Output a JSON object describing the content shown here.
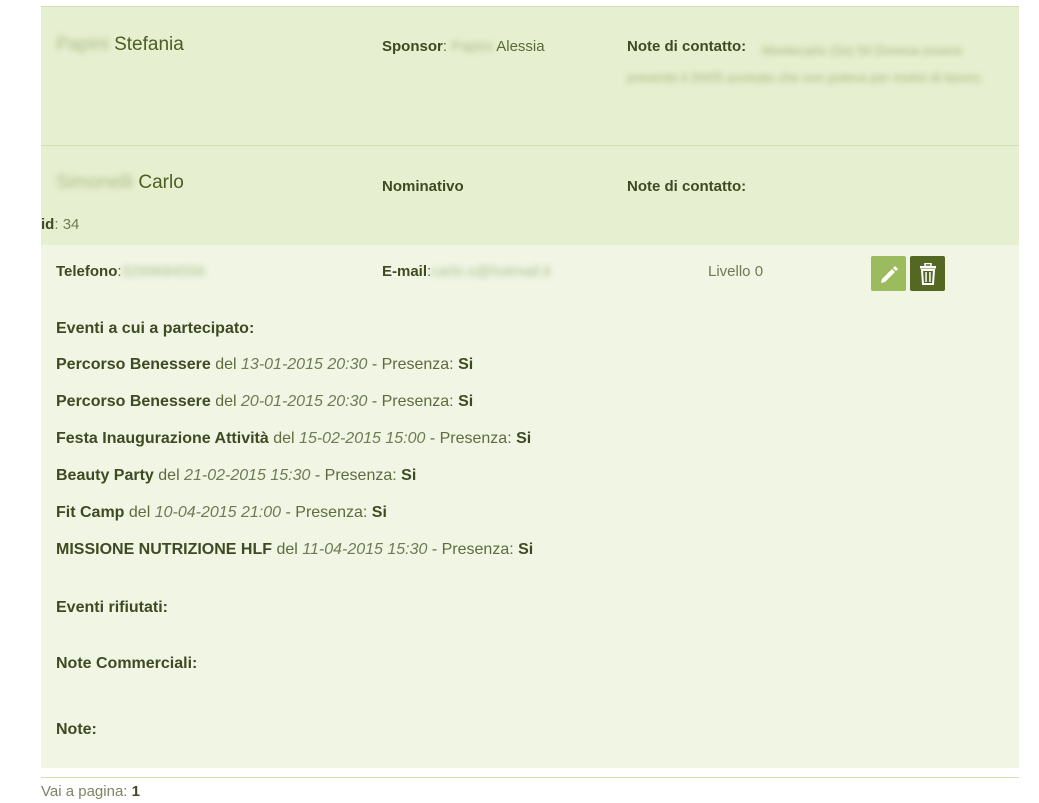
{
  "records": [
    {
      "surname": "Papini",
      "first_name": "Stefania",
      "sponsor_label": "Sponsor",
      "sponsor_surname": "Papini",
      "sponsor_first": "Alessia",
      "notes_label": "Note di contatto:",
      "notes_text": "Montecarlo (Ss) 50 Dovesa essere presente il 20/05 avvisato che non poteva per motivi di lavoro."
    },
    {
      "surname": "Simonelli",
      "first_name": "Carlo",
      "type_label": "Nominativo",
      "notes_label": "Note di contatto:"
    }
  ],
  "id_line": {
    "label": "id",
    "value": "34"
  },
  "detail": {
    "phone_label": "Telefono",
    "phone_value": "3299684556",
    "email_label": "E-mail",
    "email_value": "carlo.s@hotmail.it",
    "level": "Livello 0",
    "edit_icon": "pencil-icon",
    "delete_icon": "trash-icon",
    "events_title": "Eventi a cui a partecipato:",
    "events": [
      {
        "name": "Percorso Benessere",
        "date": "13-01-2015 20:30",
        "presence": "Si"
      },
      {
        "name": "Percorso Benessere",
        "date": "20-01-2015 20:30",
        "presence": "Si"
      },
      {
        "name": "Festa Inaugurazione Attività",
        "date": "15-02-2015 15:00",
        "presence": "Si"
      },
      {
        "name": "Beauty Party",
        "date": "21-02-2015 15:30",
        "presence": "Si"
      },
      {
        "name": "Fit Camp",
        "date": "10-04-2015 21:00",
        "presence": "Si"
      },
      {
        "name": "MISSIONE NUTRIZIONE HLF",
        "date": "11-04-2015 15:30",
        "presence": "Si"
      }
    ],
    "del_word": "del",
    "presence_word": "- Presenza:",
    "refused_title": "Eventi rifiutati:",
    "commercial_title": "Note Commerciali:",
    "notes_title": "Note:"
  },
  "pager": {
    "label": "Vai a pagina:",
    "page": "1"
  },
  "colors": {
    "header_bg": "#e6efcf",
    "detail_bg": "#f0f5e4",
    "edit_btn": "#9bbb5e",
    "delete_btn": "#546823"
  }
}
